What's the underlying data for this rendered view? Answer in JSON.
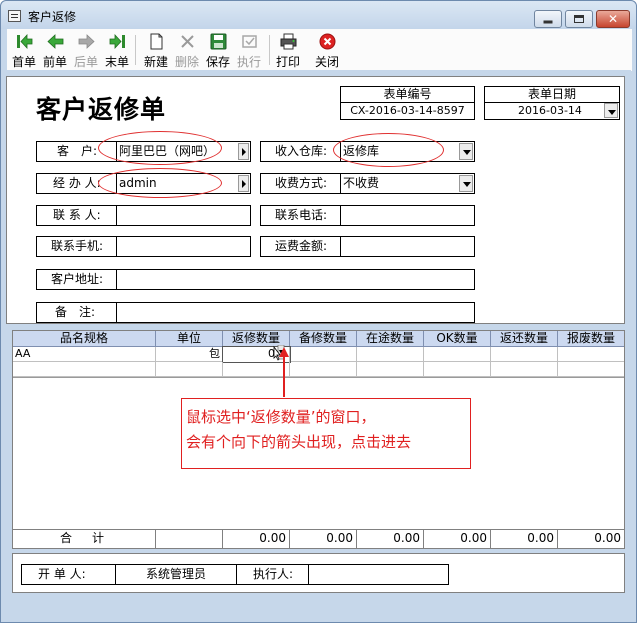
{
  "window": {
    "title": "客户返修"
  },
  "toolbar": {
    "first": "首单",
    "prev": "前单",
    "next": "后单",
    "last": "末单",
    "new": "新建",
    "delete": "删除",
    "save": "保存",
    "execute": "执行",
    "print": "打印",
    "close": "关闭"
  },
  "form": {
    "heading": "客户返修单",
    "doc_no_label": "表单编号",
    "doc_no": "CX-2016-03-14-8597",
    "doc_date_label": "表单日期",
    "doc_date": "2016-03-14",
    "customer_label": "客　户:",
    "customer": "阿里巴巴（网吧）",
    "warehouse_label": "收入仓库:",
    "warehouse": "返修库",
    "handler_label": "经 办 人:",
    "handler": "admin",
    "fee_label": "收费方式:",
    "fee": "不收费",
    "contact_label": "联 系 人:",
    "contact": "",
    "phone_label": "联系电话:",
    "phone": "",
    "mobile_label": "联系手机:",
    "mobile": "",
    "freight_label": "运费金额:",
    "freight": "",
    "address_label": "客户地址:",
    "address": "",
    "remark_label": "备　注:",
    "remark": ""
  },
  "grid": {
    "columns": [
      "品名规格",
      "单位",
      "返修数量",
      "备修数量",
      "在途数量",
      "OK数量",
      "返还数量",
      "报废数量"
    ],
    "rows": [
      {
        "name": "AA",
        "unit": "包",
        "repair_qty": "0"
      }
    ],
    "totals_label": "合　计",
    "totals": [
      "0.00",
      "0.00",
      "0.00",
      "0.00",
      "0.00",
      "0.00"
    ]
  },
  "footer": {
    "creator_label": "开 单 人:",
    "creator": "系统管理员",
    "executor_label": "执行人:",
    "executor": ""
  },
  "annotation": {
    "line1": "鼠标选中‘返修数量’的窗口，",
    "line2": "会有个向下的箭头出现，点击进去"
  },
  "colors": {
    "annotation": "#e02020",
    "grid_header": "#ccd9f0",
    "window_frame": "#c6d7ea"
  }
}
